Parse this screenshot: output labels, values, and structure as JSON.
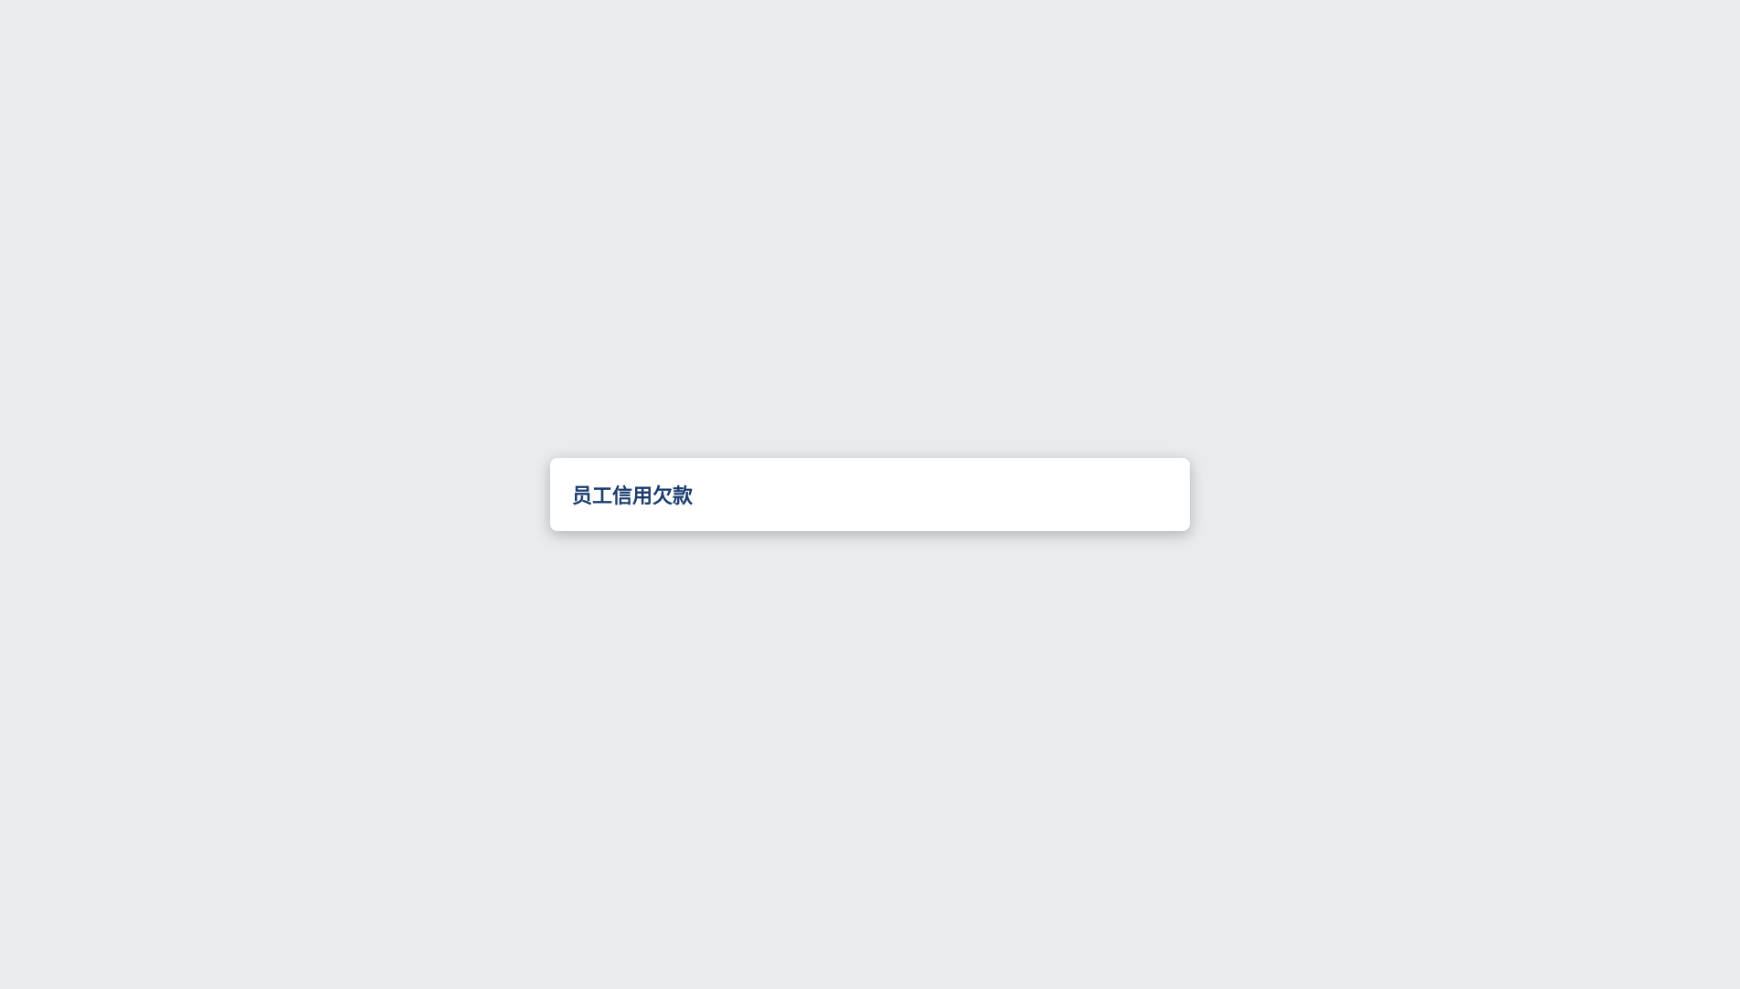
{
  "dialog": {
    "title": "员工信用欠款"
  }
}
